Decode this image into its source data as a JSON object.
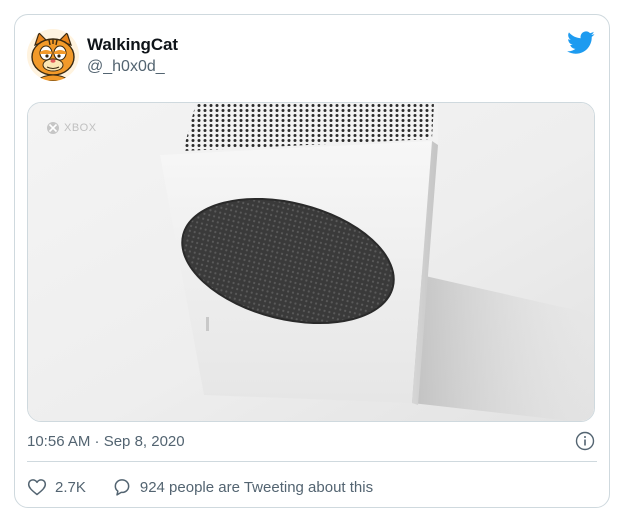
{
  "author": {
    "display_name": "WalkingCat",
    "handle": "@_h0x0d_",
    "avatar_icon": "garfield-avatar"
  },
  "brand": {
    "icon": "twitter-bird-icon",
    "color": "#1d9bf0"
  },
  "media": {
    "watermark": "XBOX",
    "alt": "Xbox Series S console"
  },
  "meta": {
    "timestamp": "10:56 AM · Sep 8, 2020",
    "info_icon": "info-icon"
  },
  "actions": {
    "likes": "2.7K",
    "conversation": "924 people are Tweeting about this"
  }
}
